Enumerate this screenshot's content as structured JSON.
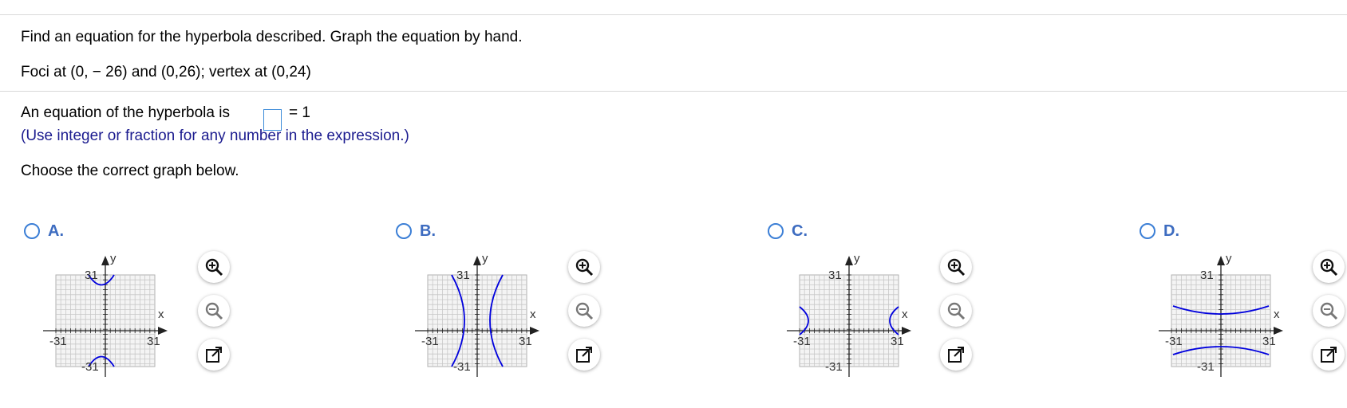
{
  "question": {
    "instruction": "Find an equation for the hyperbola described. Graph the equation by hand.",
    "given": "Foci at (0, − 26) and (0,26); vertex at (0,24)"
  },
  "answer": {
    "prefix": "An equation of the hyperbola is",
    "suffix": "= 1",
    "value": "",
    "hint": "(Use integer or fraction for any number in the expression.)"
  },
  "choose_prompt": "Choose the correct graph below.",
  "options": [
    {
      "letter": "A.",
      "selected": false,
      "curve": "vertical-hyperbola-opening-beyond-view"
    },
    {
      "letter": "B.",
      "selected": false,
      "curve": "horizontal-hyperbola-narrow"
    },
    {
      "letter": "C.",
      "selected": false,
      "curve": "horizontal-hyperbola-wide"
    },
    {
      "letter": "D.",
      "selected": false,
      "curve": "vertical-hyperbola"
    }
  ],
  "graph_labels": {
    "axis_x": "x",
    "axis_y": "y",
    "pos": "31",
    "neg": "-31"
  },
  "tools": [
    "zoom-in-icon",
    "zoom-out-icon",
    "open-new-window-icon"
  ],
  "colors": {
    "curve": "#0000dd",
    "radio": "#3c7fd6",
    "letter": "#3d6cc0",
    "hint": "#1b1b8f",
    "grid": "#c8c8c8"
  }
}
